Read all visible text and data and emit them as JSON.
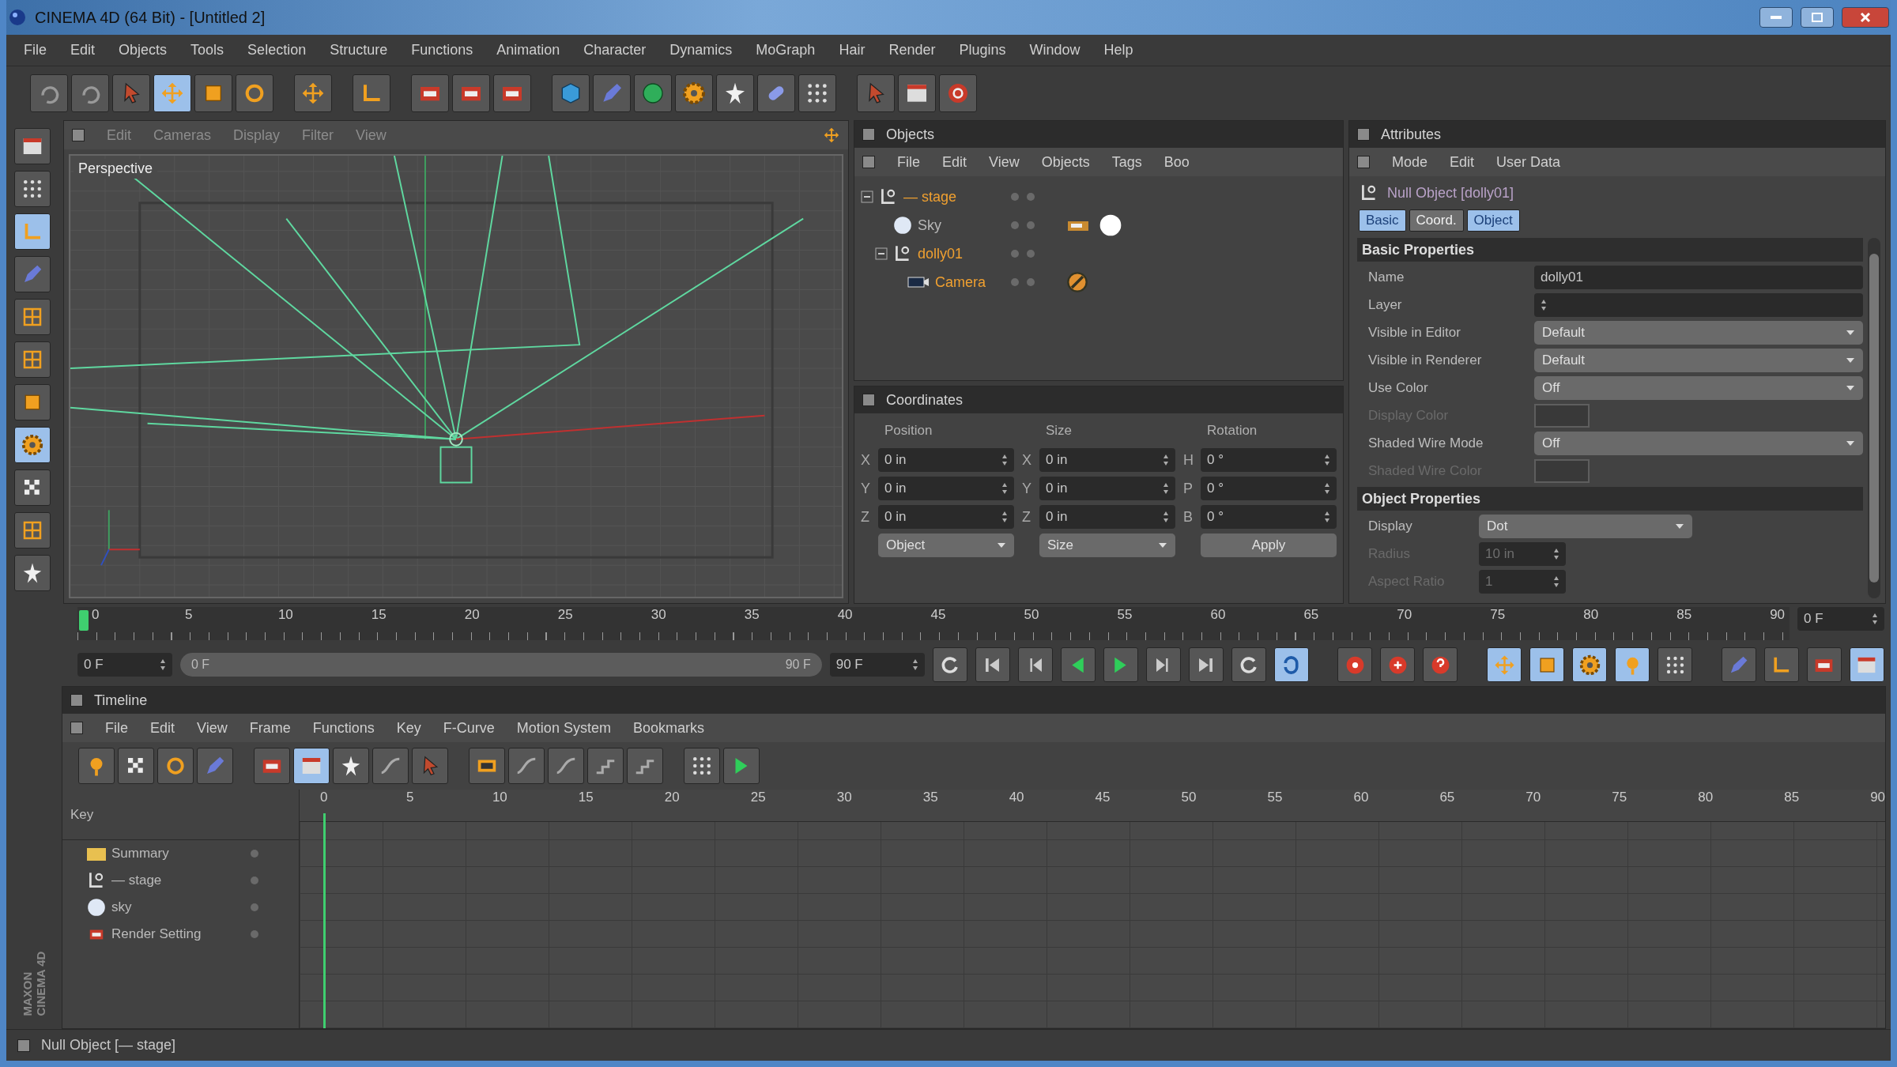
{
  "window": {
    "title": "CINEMA 4D (64 Bit) - [Untitled 2]"
  },
  "menu": [
    "File",
    "Edit",
    "Objects",
    "Tools",
    "Selection",
    "Structure",
    "Functions",
    "Animation",
    "Character",
    "Dynamics",
    "MoGraph",
    "Hair",
    "Render",
    "Plugins",
    "Window",
    "Help"
  ],
  "toolbar": [
    {
      "kind": "curved-arrow",
      "selected": false
    },
    {
      "kind": "curved-arrow",
      "selected": false
    },
    {
      "kind": "pointer",
      "selected": false
    },
    {
      "kind": "cross-arrows",
      "selected": true
    },
    {
      "kind": "square",
      "selected": false
    },
    {
      "kind": "ring",
      "selected": false
    },
    {
      "kind": "gap"
    },
    {
      "kind": "cross-arrows",
      "selected": false
    },
    {
      "kind": "gap"
    },
    {
      "kind": "axis",
      "selected": false
    },
    {
      "kind": "gap"
    },
    {
      "kind": "clapper",
      "selected": false
    },
    {
      "kind": "clapper",
      "selected": false
    },
    {
      "kind": "clapper",
      "selected": false
    },
    {
      "kind": "gap"
    },
    {
      "kind": "cube",
      "selected": false
    },
    {
      "kind": "pen",
      "selected": false
    },
    {
      "kind": "sphere",
      "selected": false
    },
    {
      "kind": "gear",
      "selected": false
    },
    {
      "kind": "star",
      "selected": false
    },
    {
      "kind": "capsule",
      "selected": false
    },
    {
      "kind": "dots",
      "selected": false
    },
    {
      "kind": "gap"
    },
    {
      "kind": "pointer",
      "selected": false
    },
    {
      "kind": "window",
      "selected": false
    },
    {
      "kind": "power",
      "selected": false
    }
  ],
  "side_toolbar": [
    {
      "kind": "window",
      "selected": false
    },
    {
      "kind": "dots",
      "selected": false
    },
    {
      "kind": "axis",
      "selected": true
    },
    {
      "kind": "pen",
      "selected": false
    },
    {
      "kind": "grid",
      "selected": false
    },
    {
      "kind": "grid",
      "selected": false
    },
    {
      "kind": "square",
      "selected": false
    },
    {
      "kind": "gear",
      "selected": true
    },
    {
      "kind": "checker",
      "selected": false
    },
    {
      "kind": "grid",
      "selected": false
    },
    {
      "kind": "star",
      "selected": false
    }
  ],
  "viewport": {
    "menu": [
      "Edit",
      "Cameras",
      "Display",
      "Filter",
      "View"
    ],
    "label": "Perspective"
  },
  "objects": {
    "title": "Objects",
    "menu": [
      "File",
      "Edit",
      "View",
      "Objects",
      "Tags",
      "Boo"
    ],
    "tree": [
      {
        "name": "— stage",
        "kind": "null",
        "selected": true,
        "expanded": true,
        "children": [
          {
            "name": "Sky",
            "kind": "sky",
            "selected": false,
            "tags": [
              {
                "kind": "clapper"
              },
              {
                "kind": "glow"
              }
            ]
          },
          {
            "name": "dolly01",
            "kind": "null",
            "selected": true,
            "expanded": true,
            "children": [
              {
                "name": "Camera",
                "kind": "camera",
                "selected": true,
                "tags": [
                  {
                    "kind": "target"
                  }
                ]
              }
            ]
          }
        ]
      }
    ]
  },
  "coordinates": {
    "title": "Coordinates",
    "headers": [
      "Position",
      "Size",
      "Rotation"
    ],
    "rows": [
      {
        "cells": [
          {
            "axis": "X",
            "value": "0 in"
          },
          {
            "axis": "X",
            "value": "0 in"
          },
          {
            "axis": "H",
            "value": "0 °"
          }
        ]
      },
      {
        "cells": [
          {
            "axis": "Y",
            "value": "0 in"
          },
          {
            "axis": "Y",
            "value": "0 in"
          },
          {
            "axis": "P",
            "value": "0 °"
          }
        ]
      },
      {
        "cells": [
          {
            "axis": "Z",
            "value": "0 in"
          },
          {
            "axis": "Z",
            "value": "0 in"
          },
          {
            "axis": "B",
            "value": "0 °"
          }
        ]
      }
    ],
    "dropdowns": [
      "Object",
      "Size"
    ],
    "apply": "Apply"
  },
  "attributes": {
    "title": "Attributes",
    "menu": [
      "Mode",
      "Edit",
      "User Data"
    ],
    "object": "Null Object [dolly01]",
    "tabs": [
      {
        "label": "Basic",
        "selected": true
      },
      {
        "label": "Coord.",
        "selected": false
      },
      {
        "label": "Object",
        "selected": true
      }
    ],
    "sections": [
      {
        "title": "Basic Properties",
        "fields": [
          {
            "label": "Name",
            "kind": "text",
            "value": "dolly01"
          },
          {
            "label": "Layer",
            "kind": "layer"
          },
          {
            "label": "Visible in Editor",
            "kind": "dropdown",
            "value": "Default"
          },
          {
            "label": "Visible in Renderer",
            "kind": "dropdown",
            "value": "Default"
          },
          {
            "label": "Use Color",
            "kind": "dropdown",
            "value": "Off"
          },
          {
            "label": "Display Color",
            "kind": "color",
            "disabled": true
          },
          {
            "label": "Shaded Wire Mode",
            "kind": "dropdown",
            "value": "Off"
          },
          {
            "label": "Shaded Wire Color",
            "kind": "color",
            "disabled": true
          }
        ]
      },
      {
        "title": "Object Properties",
        "fields": [
          {
            "label": "Display",
            "kind": "short-dropdown",
            "value": "Dot"
          },
          {
            "label": "Radius",
            "kind": "number",
            "value": "10 in",
            "disabled": true
          },
          {
            "label": "Aspect Ratio",
            "kind": "number",
            "value": "1",
            "disabled": true
          }
        ]
      }
    ]
  },
  "time_ruler": {
    "labels": [
      "0",
      "5",
      "10",
      "15",
      "20",
      "25",
      "30",
      "35",
      "40",
      "45",
      "50",
      "55",
      "60",
      "65",
      "70",
      "75",
      "80",
      "85",
      "90"
    ],
    "frame": "0 F"
  },
  "playback": {
    "start": "0 F",
    "range_start": "0 F",
    "range_end": "90 F",
    "level": 1,
    "end": "90 F",
    "buttons": [
      {
        "kind": "circle-arrow",
        "selected": false
      },
      {
        "kind": "skip-back",
        "selected": false
      },
      {
        "kind": "step-back",
        "selected": false
      },
      {
        "kind": "play-back",
        "selected": false
      },
      {
        "kind": "play",
        "selected": false
      },
      {
        "kind": "step",
        "selected": false
      },
      {
        "kind": "skip",
        "selected": false
      },
      {
        "kind": "circle-arrow",
        "selected": false
      },
      {
        "kind": "loop",
        "selected": true
      },
      {
        "kind": "gap"
      },
      {
        "kind": "record",
        "selected": false
      },
      {
        "kind": "key",
        "selected": false
      },
      {
        "kind": "question",
        "selected": false
      },
      {
        "kind": "gap"
      },
      {
        "kind": "cross-arrows",
        "selected": true
      },
      {
        "kind": "square",
        "selected": true
      },
      {
        "kind": "gear",
        "selected": true
      },
      {
        "kind": "pin",
        "selected": true
      },
      {
        "kind": "dots",
        "selected": false
      },
      {
        "kind": "gap"
      },
      {
        "kind": "pen",
        "selected": false
      },
      {
        "kind": "axis",
        "selected": false
      },
      {
        "kind": "clapper",
        "selected": false
      },
      {
        "kind": "window",
        "selected": true
      }
    ]
  },
  "timeline": {
    "title": "Timeline",
    "menu": [
      "File",
      "Edit",
      "View",
      "Frame",
      "Functions",
      "Key",
      "F-Curve",
      "Motion System",
      "Bookmarks"
    ],
    "tools": [
      {
        "kind": "pin",
        "selected": false
      },
      {
        "kind": "checker",
        "selected": false
      },
      {
        "kind": "ring",
        "selected": false
      },
      {
        "kind": "pen",
        "selected": false
      },
      {
        "kind": "gap"
      },
      {
        "kind": "clapper",
        "selected": false
      },
      {
        "kind": "window",
        "selected": true
      },
      {
        "kind": "star",
        "selected": false
      },
      {
        "kind": "curve",
        "selected": false
      },
      {
        "kind": "pointer",
        "selected": false
      },
      {
        "kind": "gap"
      },
      {
        "kind": "film",
        "selected": false
      },
      {
        "kind": "curve",
        "selected": false
      },
      {
        "kind": "curve",
        "selected": false
      },
      {
        "kind": "steps",
        "selected": false
      },
      {
        "kind": "steps",
        "selected": false
      },
      {
        "kind": "gap"
      },
      {
        "kind": "dots",
        "selected": false
      },
      {
        "kind": "play",
        "selected": false
      }
    ],
    "key_label": "Key",
    "ruler": [
      "0",
      "5",
      "10",
      "15",
      "20",
      "25",
      "30",
      "35",
      "40",
      "45",
      "50",
      "55",
      "60",
      "65",
      "70",
      "75",
      "80",
      "85",
      "90"
    ],
    "tracks": [
      {
        "name": "Summary",
        "kind": "folder"
      },
      {
        "name": "— stage",
        "kind": "null"
      },
      {
        "name": "sky",
        "kind": "sky"
      },
      {
        "name": "Render Setting",
        "kind": "render"
      }
    ]
  },
  "brand": [
    "MAXON",
    "CINEMA 4D"
  ],
  "status_bar": "Null Object [— stage]"
}
